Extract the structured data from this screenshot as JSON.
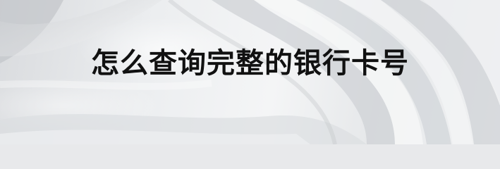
{
  "banner": {
    "title": "怎么查询完整的银行卡号"
  },
  "colors": {
    "background": "#e8e9eb",
    "text": "#111111"
  }
}
